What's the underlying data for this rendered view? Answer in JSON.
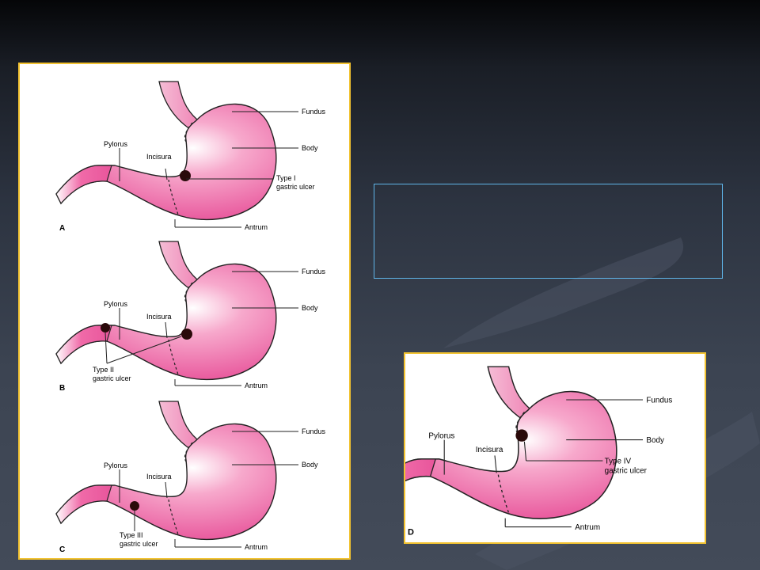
{
  "slide": {
    "colors": {
      "background": "#3c4452",
      "panel_border": "#f2c230",
      "textbox_border": "#5fb4e8",
      "stomach": "#e8559b",
      "ulcer": "#2a0a0a"
    },
    "textbox": {
      "text": ""
    }
  },
  "diagrams": [
    {
      "letter": "A",
      "labels": {
        "fundus": "Fundus",
        "body": "Body",
        "pylorus": "Pylorus",
        "incisura": "Incisura",
        "antrum": "Antrum",
        "ulcer_line1": "Type I",
        "ulcer_line2": "gastric ulcer"
      }
    },
    {
      "letter": "B",
      "labels": {
        "fundus": "Fundus",
        "body": "Body",
        "pylorus": "Pylorus",
        "incisura": "Incisura",
        "antrum": "Antrum",
        "ulcer_line1": "Type II",
        "ulcer_line2": "gastric ulcer"
      }
    },
    {
      "letter": "C",
      "labels": {
        "fundus": "Fundus",
        "body": "Body",
        "pylorus": "Pylorus",
        "incisura": "Incisura",
        "antrum": "Antrum",
        "ulcer_line1": "Type III",
        "ulcer_line2": "gastric ulcer"
      }
    },
    {
      "letter": "D",
      "labels": {
        "fundus": "Fundus",
        "body": "Body",
        "pylorus": "Pylorus",
        "incisura": "Incisura",
        "antrum": "Antrum",
        "ulcer_line1": "Type IV",
        "ulcer_line2": "gastric ulcer"
      }
    }
  ]
}
